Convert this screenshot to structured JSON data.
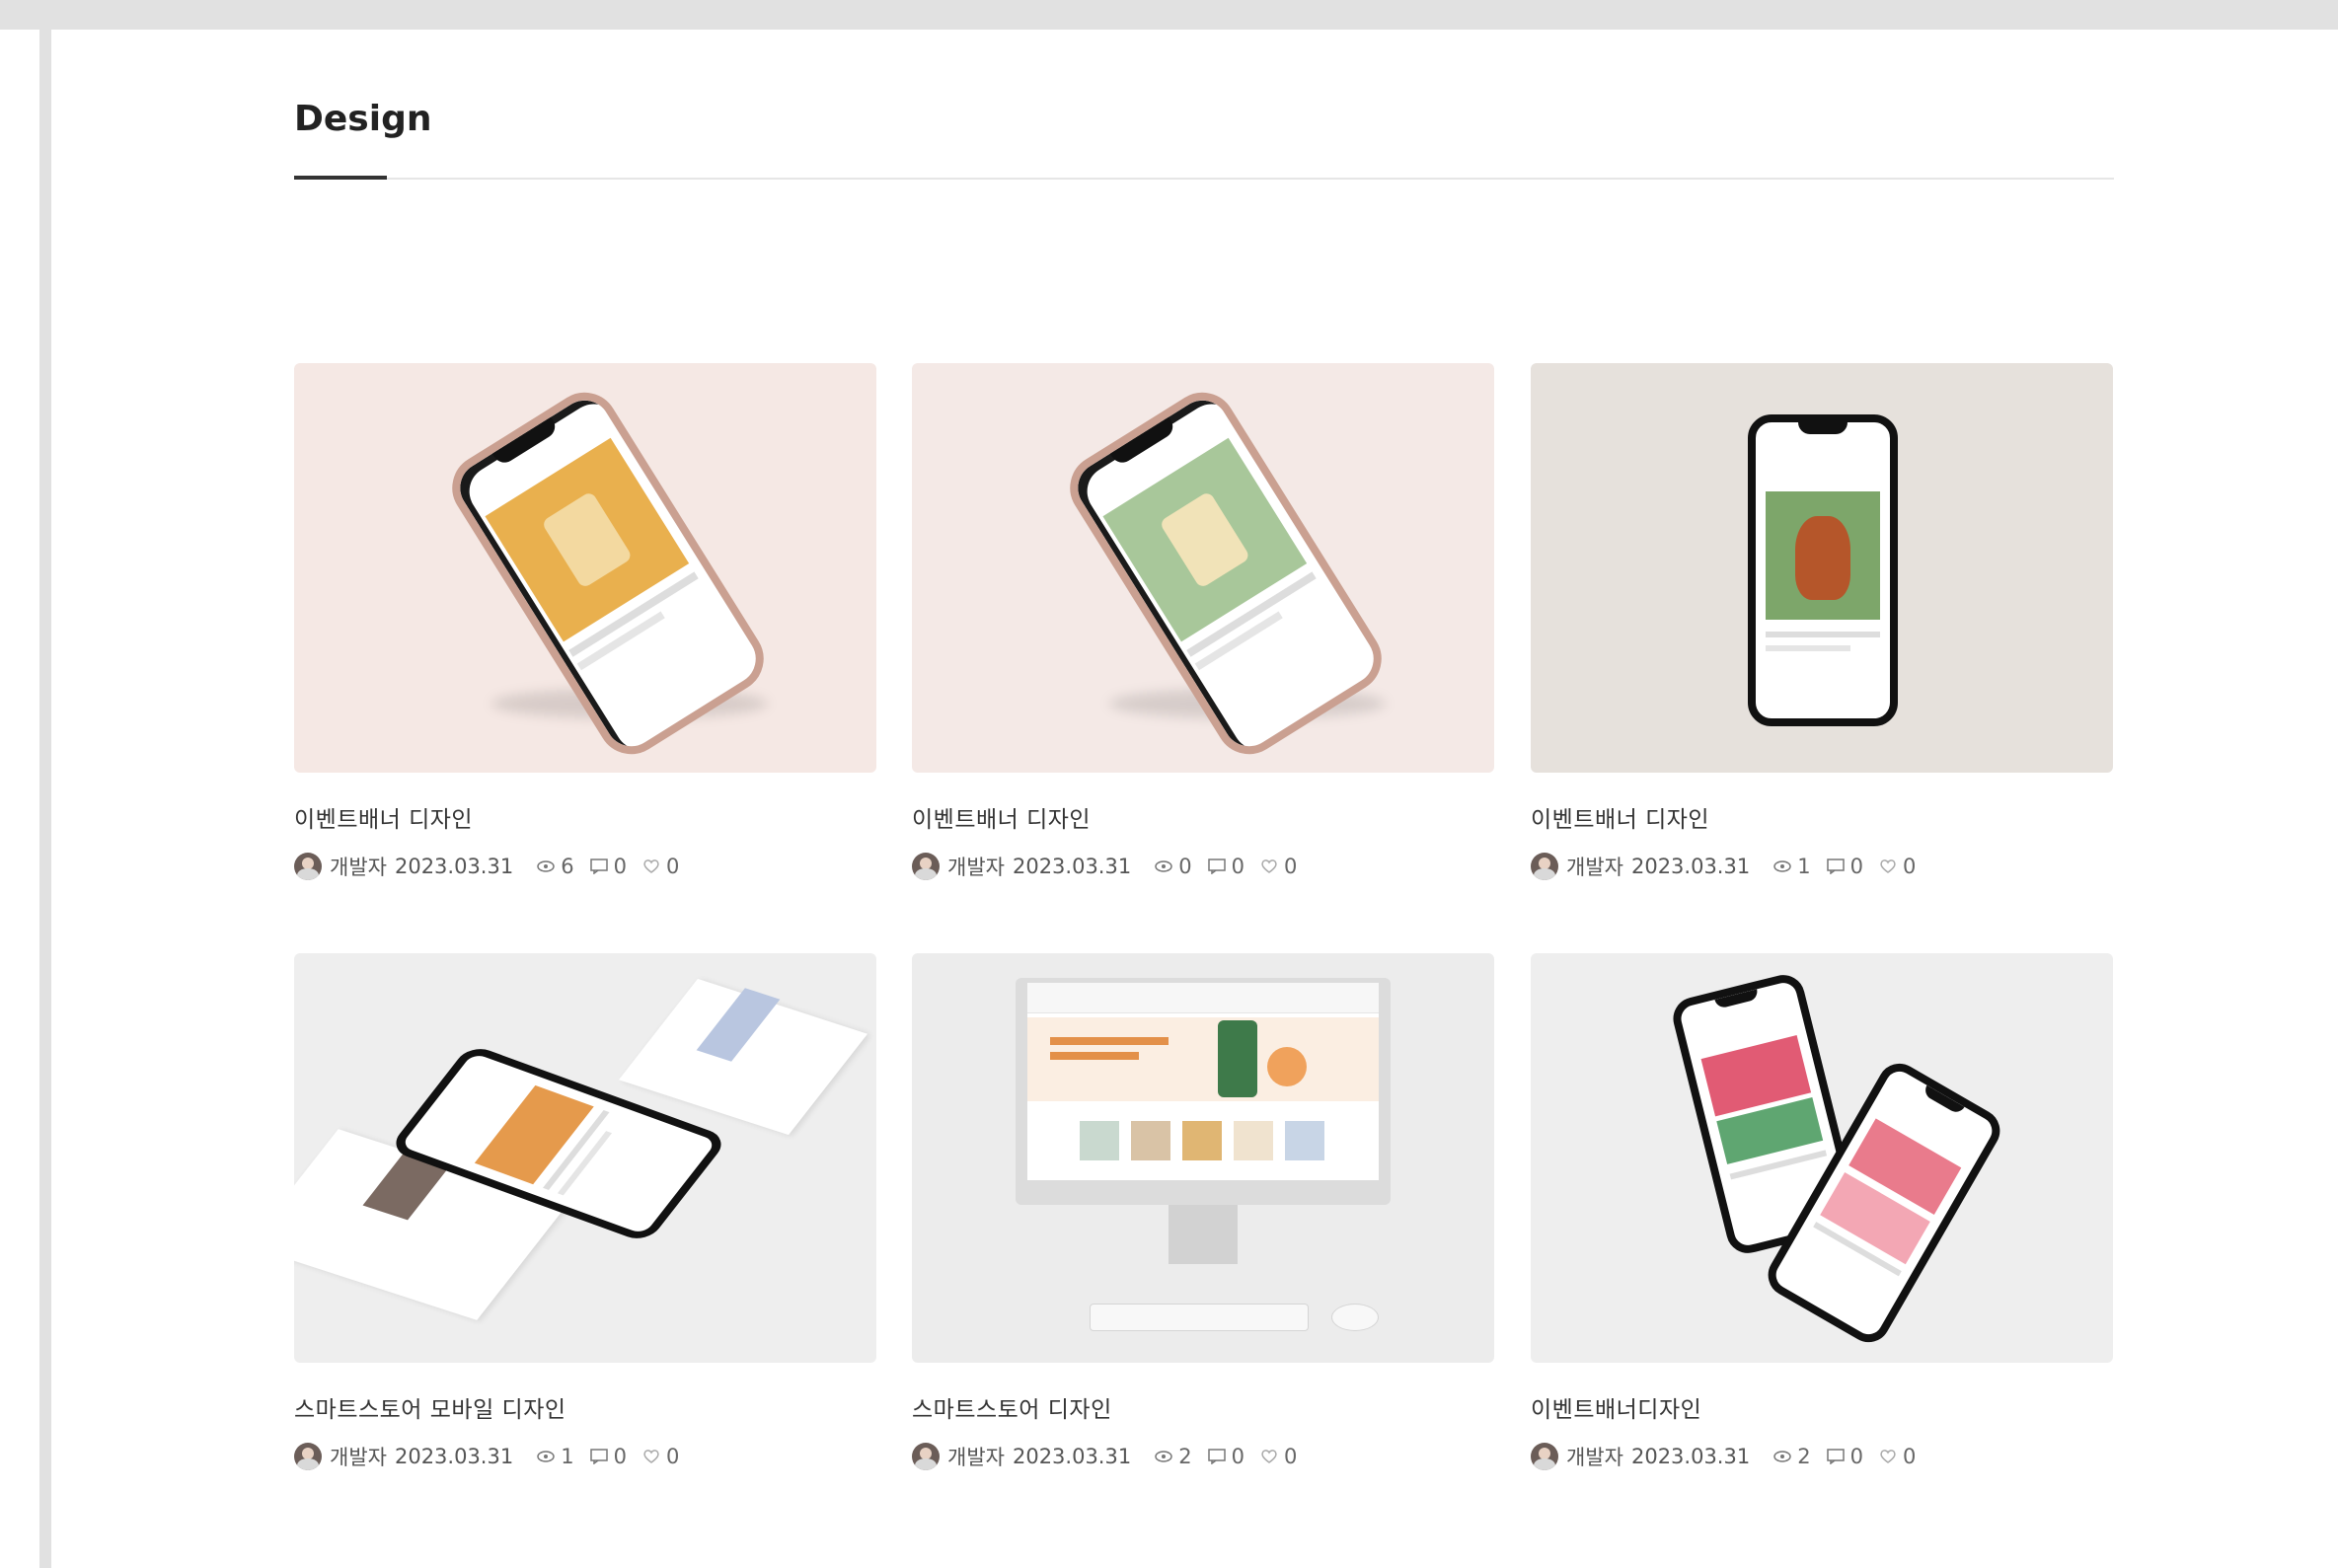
{
  "section": {
    "title": "Design"
  },
  "cards": [
    {
      "title": "이벤트배너 디자인",
      "author": "개발자",
      "date": "2023.03.31",
      "views": "6",
      "comments": "0",
      "likes": "0",
      "bg": "#f5e8e4"
    },
    {
      "title": "이벤트배너 디자인",
      "author": "개발자",
      "date": "2023.03.31",
      "views": "0",
      "comments": "0",
      "likes": "0",
      "bg": "#f4e9e6"
    },
    {
      "title": "이벤트배너 디자인",
      "author": "개발자",
      "date": "2023.03.31",
      "views": "1",
      "comments": "0",
      "likes": "0",
      "bg": "#e6e1dc"
    },
    {
      "title": "스마트스토어 모바일 디자인",
      "author": "개발자",
      "date": "2023.03.31",
      "views": "1",
      "comments": "0",
      "likes": "0",
      "bg": "#eeeeee"
    },
    {
      "title": "스마트스토어 디자인",
      "author": "개발자",
      "date": "2023.03.31",
      "views": "2",
      "comments": "0",
      "likes": "0",
      "bg": "#ececec"
    },
    {
      "title": "이벤트배너디자인",
      "author": "개발자",
      "date": "2023.03.31",
      "views": "2",
      "comments": "0",
      "likes": "0",
      "bg": "#eeeeee"
    }
  ]
}
